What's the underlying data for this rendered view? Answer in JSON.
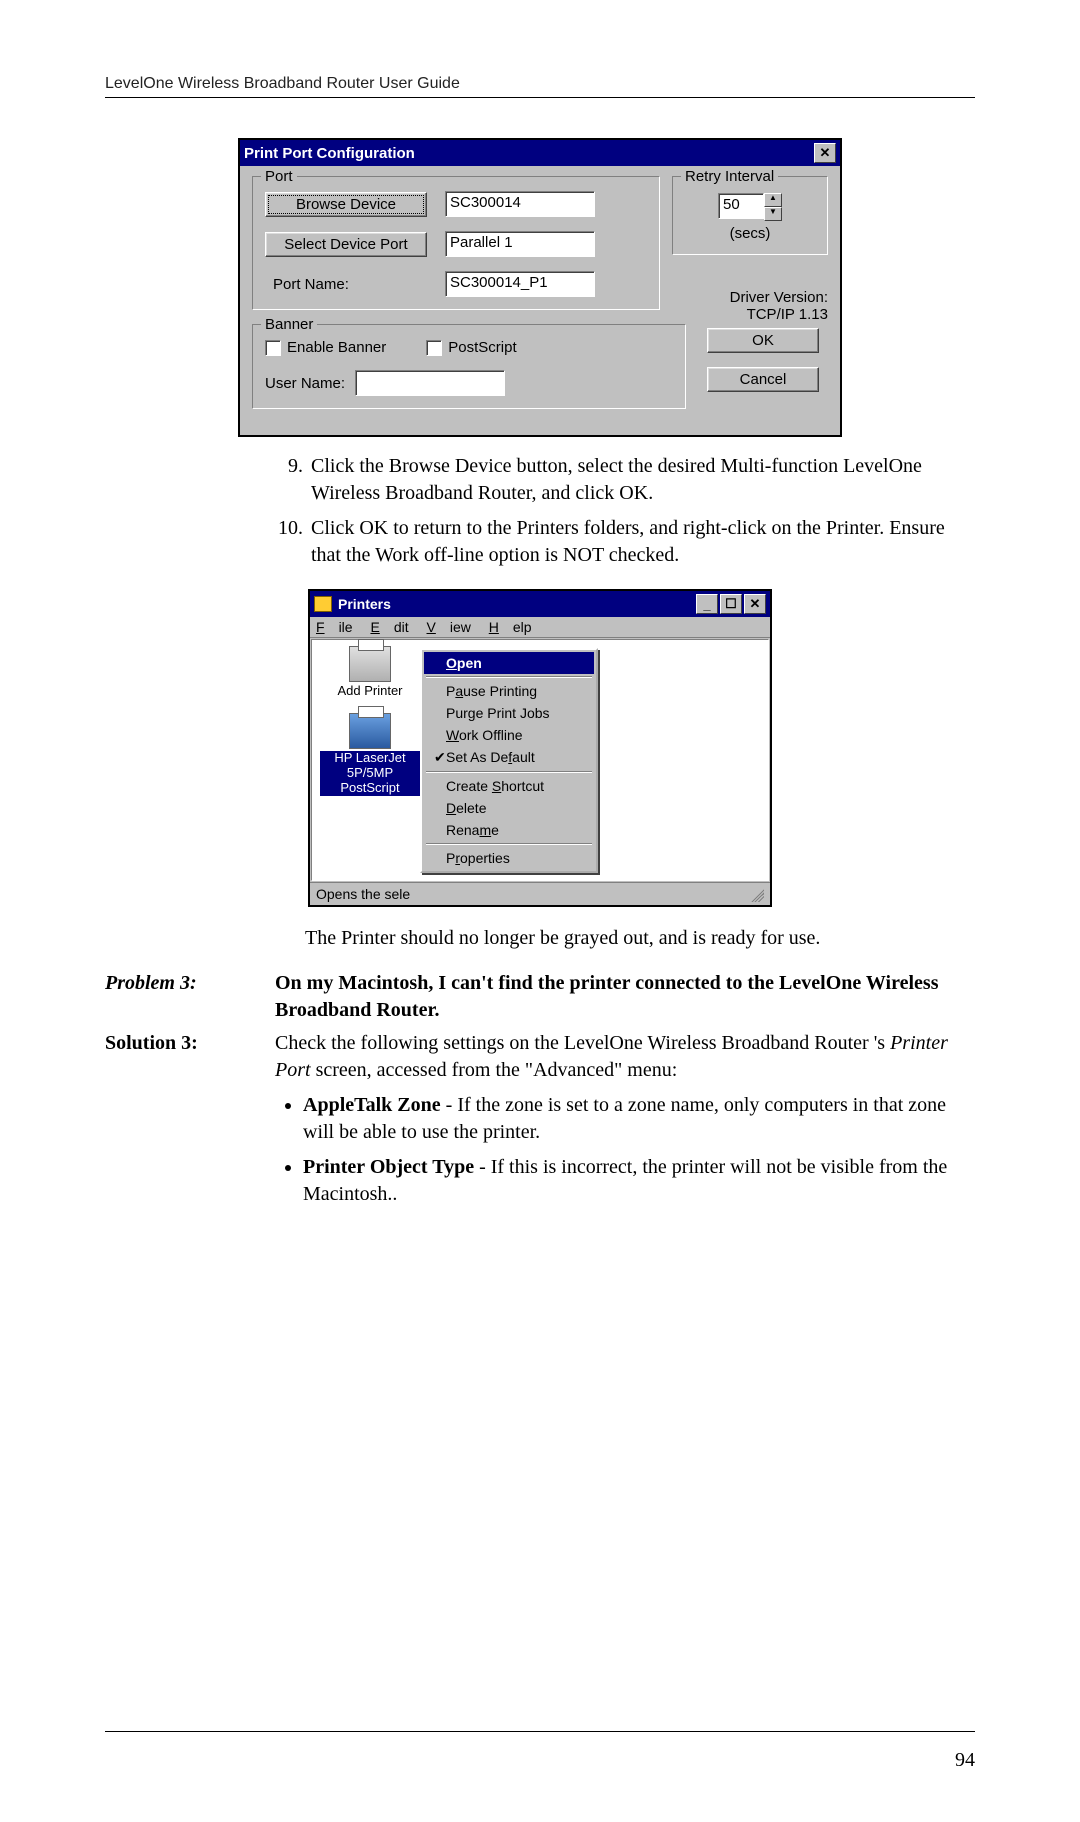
{
  "header": "LevelOne Wireless Broadband Router User Guide",
  "page_number": "94",
  "dialog1": {
    "title": "Print Port Configuration",
    "port_group": "Port",
    "browse_device_btn": "Browse Device",
    "browse_device_val": "SC300014",
    "select_port_btn": "Select Device Port",
    "select_port_val": "Parallel 1",
    "port_name_label": "Port Name:",
    "port_name_val": "SC300014_P1",
    "retry_group": "Retry Interval",
    "retry_val": "50",
    "retry_unit": "(secs)",
    "driver_line1": "Driver Version:",
    "driver_line2": "TCP/IP  1.13",
    "banner_group": "Banner",
    "enable_banner": "Enable Banner",
    "postscript": "PostScript",
    "user_name_label": "User Name:",
    "ok_btn": "OK",
    "cancel_btn": "Cancel"
  },
  "instructions": {
    "n9": "9.",
    "t9": "Click the Browse Device button, select the desired Multi-function LevelOne Wireless Broadband Router, and click OK.",
    "n10": "10.",
    "t10": "Click OK to return to the Printers folders, and right-click on the Printer. Ensure that the Work off-line option is NOT checked."
  },
  "dialog2": {
    "title": "Printers",
    "menus": {
      "file": "File",
      "edit": "Edit",
      "view": "View",
      "help": "Help"
    },
    "add_printer": "Add Printer",
    "selected_printer_l1": "HP LaserJet",
    "selected_printer_l2": "5P/5MP",
    "selected_printer_l3": "PostScript",
    "context": {
      "open": "Open",
      "pause": "Pause Printing",
      "purge": "Purge Print Jobs",
      "work_offline": "Work Offline",
      "set_default": "Set As Default",
      "create_shortcut": "Create Shortcut",
      "delete": "Delete",
      "rename": "Rename",
      "properties": "Properties"
    },
    "status": "Opens the sele"
  },
  "after_para": "The Printer should no longer be grayed out, and is ready for use.",
  "problem3": {
    "label": "Problem 3:",
    "text": "On my Macintosh, I can't find the printer connected to the LevelOne Wireless Broadband Router."
  },
  "solution3": {
    "label": "Solution 3:",
    "intro_a": "Check the following settings on the LevelOne Wireless Broadband Router 's ",
    "intro_b": "Printer Port",
    "intro_c": " screen, accessed from the \"Advanced\" menu:",
    "bullet1_b": "AppleTalk Zone",
    "bullet1_t": " - If the zone is set to a zone name, only computers in that zone will be able to use the printer.",
    "bullet2_b": "Printer Object Type",
    "bullet2_t": " - If this is incorrect, the printer will not be visible from the Macintosh.."
  }
}
